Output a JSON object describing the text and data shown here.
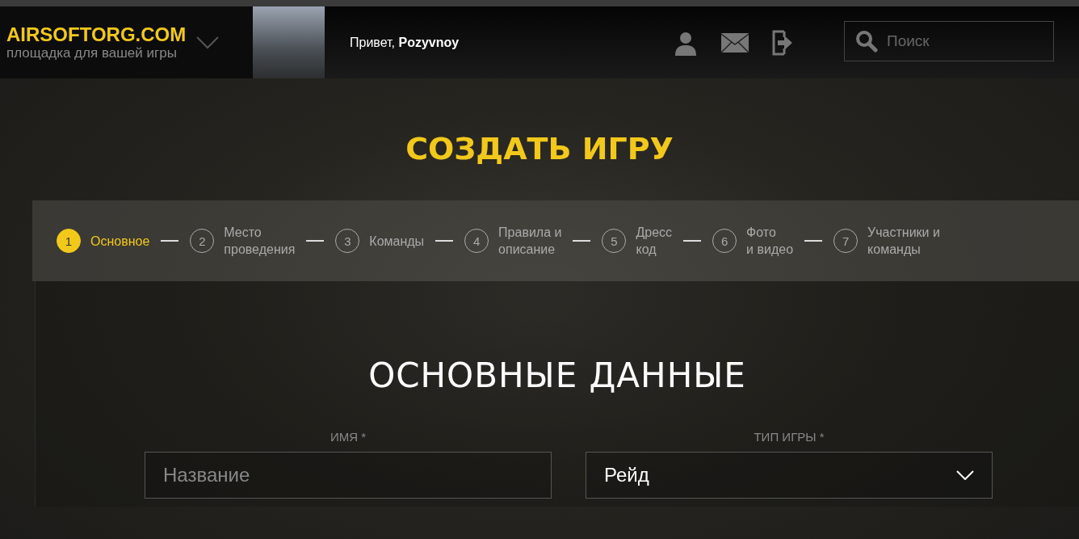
{
  "header": {
    "logo": "AIRSOFTORG.COM",
    "tagline": "площадка для вашей игры",
    "greeting": "Привет, **Pozyvnoy**",
    "search": {
      "placeholder": "Поиск"
    }
  },
  "page_title": "СОЗДАТЬ ИГРУ",
  "steps": [
    {
      "number": "1",
      "label": "Основное",
      "selected": true
    },
    {
      "number": "2",
      "label": "Место\nпроведения",
      "selected": false
    },
    {
      "number": "3",
      "label": "Команды",
      "selected": false
    },
    {
      "number": "4",
      "label": "Правила и\nописание",
      "selected": false
    },
    {
      "number": "5",
      "label": "Дресс\nкод",
      "selected": false
    },
    {
      "number": "6",
      "label": "Фото\nи видео",
      "selected": false
    },
    {
      "number": "7",
      "label": "Участники и\nкоманды",
      "selected": false
    }
  ],
  "section_title": "ОСНОВНЫЕ ДАННЫЕ",
  "fields": [
    {
      "kind": "text",
      "label": "ИМЯ *",
      "placeholder": "Название"
    },
    {
      "kind": "select",
      "label": "ТИП ИГРЫ *",
      "value": "Рейд"
    }
  ]
}
